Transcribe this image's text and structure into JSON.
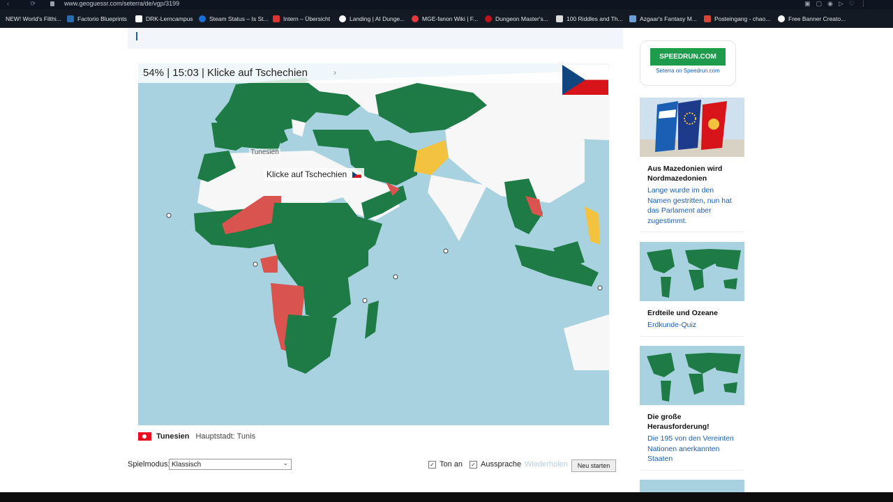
{
  "browser": {
    "url": "www.geoguessr.com/seterra/de/vgp/3199",
    "bookmarks": [
      {
        "label": "NEW! World's Filthi...",
        "color": "#3a3a3a"
      },
      {
        "label": "Factorio Blueprints",
        "color": "#2b6cb0"
      },
      {
        "label": "DRK-Lerncampus",
        "color": "#ffffff"
      },
      {
        "label": "Steam Status – Is St...",
        "color": "#1b6fd6"
      },
      {
        "label": "Intern – Übersicht",
        "color": "#d33"
      },
      {
        "label": "Landing | AI Dunge...",
        "color": "#ffffff"
      },
      {
        "label": "MGE-fanon Wiki | F...",
        "color": "#e23a3a"
      },
      {
        "label": "Dungeon Master's...",
        "color": "#c0121b"
      },
      {
        "label": "100 Riddles and Th...",
        "color": "#dddddd"
      },
      {
        "label": "Azgaar's Fantasy M...",
        "color": "#6aa0d6"
      },
      {
        "label": "Posteingang - chao...",
        "color": "#d44638"
      },
      {
        "label": "Free Banner Creato...",
        "color": "#ffffff"
      }
    ]
  },
  "game": {
    "status": "54% | 15:03 | Klicke auf Tschechien",
    "map_label": "Tunesien",
    "tooltip": "Klicke auf Tschechien",
    "target_flag": "czech-flag",
    "info_country": "Tunesien",
    "info_capital": "Hauptstadt: Tunis",
    "spielmodus_label": "Spielmodus:",
    "spielmodus_value": "Klassisch",
    "sound_label": "Ton an",
    "pronunciation_label": "Aussprache",
    "repeat_label": "Wiederholen",
    "restart_label": "Neu starten",
    "colors": {
      "correct": "#1e7b45",
      "wrong": "#d9534f",
      "partial": "#f3c33f",
      "sea": "#a9d2e0",
      "land": "#f7f7f7"
    }
  },
  "sidebar": {
    "speedrun_logo": "SPEEDRUN.COM",
    "speedrun_sub": "Seterra on Speedrun.com",
    "cards": [
      {
        "title": "Aus Mazedonien wird Nordmazedonien",
        "desc": "Lange wurde im den Namen gestritten, nun hat das Parlament aber zugestimmt."
      },
      {
        "title": "Erdteile und Ozeane",
        "desc": "Erdkunde-Quiz"
      },
      {
        "title": "Die große Herausforderung!",
        "desc": "Die 195 von den Vereinten Nationen anerkannten Staaten"
      }
    ]
  }
}
